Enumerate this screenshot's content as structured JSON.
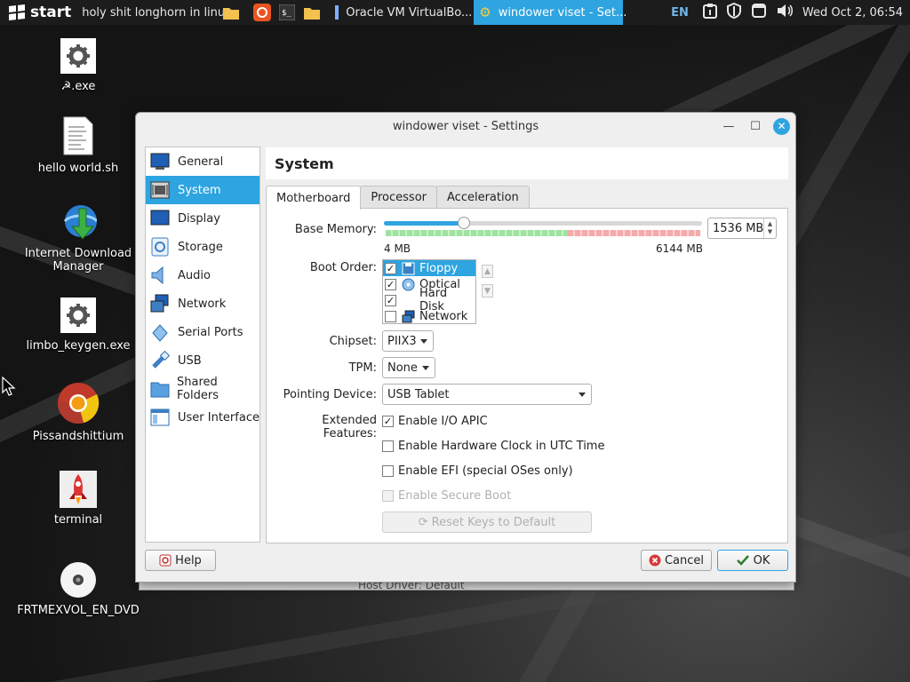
{
  "taskbar": {
    "start_label": "start",
    "tasks": [
      {
        "label": "holy shit longhorn in linux"
      },
      {
        "label": "Oracle VM VirtualBo..."
      },
      {
        "label": "windower viset - Set..."
      }
    ],
    "language": "EN",
    "clock": "Wed Oct 2, 06:54"
  },
  "desktop": {
    "icons": [
      {
        "label": "☭.exe",
        "icon": "gear-icon"
      },
      {
        "label": "hello world.sh",
        "icon": "text-file-icon"
      },
      {
        "label": "Internet Download Manager",
        "icon": "idm-icon"
      },
      {
        "label": "limbo_keygen.exe",
        "icon": "gear-icon"
      },
      {
        "label": "Pissandshittium",
        "icon": "chromium-icon"
      },
      {
        "label": "terminal",
        "icon": "rocket-icon"
      },
      {
        "label": "FRTMEXVOL_EN_DVD",
        "icon": "disc-icon"
      }
    ]
  },
  "dialog": {
    "title": "windower viset - Settings",
    "sidebar": [
      {
        "label": "General",
        "icon": "general-icon"
      },
      {
        "label": "System",
        "icon": "system-chip-icon",
        "selected": true
      },
      {
        "label": "Display",
        "icon": "display-icon"
      },
      {
        "label": "Storage",
        "icon": "storage-icon"
      },
      {
        "label": "Audio",
        "icon": "audio-icon"
      },
      {
        "label": "Network",
        "icon": "network-icon"
      },
      {
        "label": "Serial Ports",
        "icon": "serial-ports-icon"
      },
      {
        "label": "USB",
        "icon": "usb-icon"
      },
      {
        "label": "Shared Folders",
        "icon": "shared-folders-icon"
      },
      {
        "label": "User Interface",
        "icon": "user-interface-icon"
      }
    ],
    "page_title": "System",
    "tabs": [
      {
        "label": "Motherboard",
        "active": true
      },
      {
        "label": "Processor"
      },
      {
        "label": "Acceleration"
      }
    ],
    "motherboard": {
      "base_memory_label": "Base Memory:",
      "base_memory_value": "1536 MB",
      "base_memory_fraction": 0.25,
      "memory_min_label": "4 MB",
      "memory_max_label": "6144 MB",
      "boot_order_label": "Boot Order:",
      "boot_order": [
        {
          "label": "Floppy",
          "checked": true,
          "selected": true,
          "icon": "floppy-icon"
        },
        {
          "label": "Optical",
          "checked": true,
          "icon": "optical-disc-icon"
        },
        {
          "label": "Hard Disk",
          "checked": true,
          "icon": "hard-disk-icon"
        },
        {
          "label": "Network",
          "checked": false,
          "icon": "network-icon"
        }
      ],
      "chipset_label": "Chipset:",
      "chipset_value": "PIIX3",
      "tpm_label": "TPM:",
      "tpm_value": "None",
      "pointing_device_label": "Pointing Device:",
      "pointing_device_value": "USB Tablet",
      "extended_features_label": "Extended Features:",
      "features": [
        {
          "label": "Enable I/O APIC",
          "checked": true,
          "enabled": true
        },
        {
          "label": "Enable Hardware Clock in UTC Time",
          "checked": false,
          "enabled": true
        },
        {
          "label": "Enable EFI (special OSes only)",
          "checked": false,
          "enabled": true
        },
        {
          "label": "Enable Secure Boot",
          "checked": false,
          "enabled": false
        }
      ],
      "reset_keys_label": "Reset Keys to Default"
    },
    "buttons": {
      "help": "Help",
      "cancel": "Cancel",
      "ok": "OK"
    }
  },
  "background_window_text": "Host Driver: Default",
  "colors": {
    "accent": "#2ea4e0",
    "taskbar_bg": "#1c1c1c",
    "dialog_bg": "#efefef"
  }
}
